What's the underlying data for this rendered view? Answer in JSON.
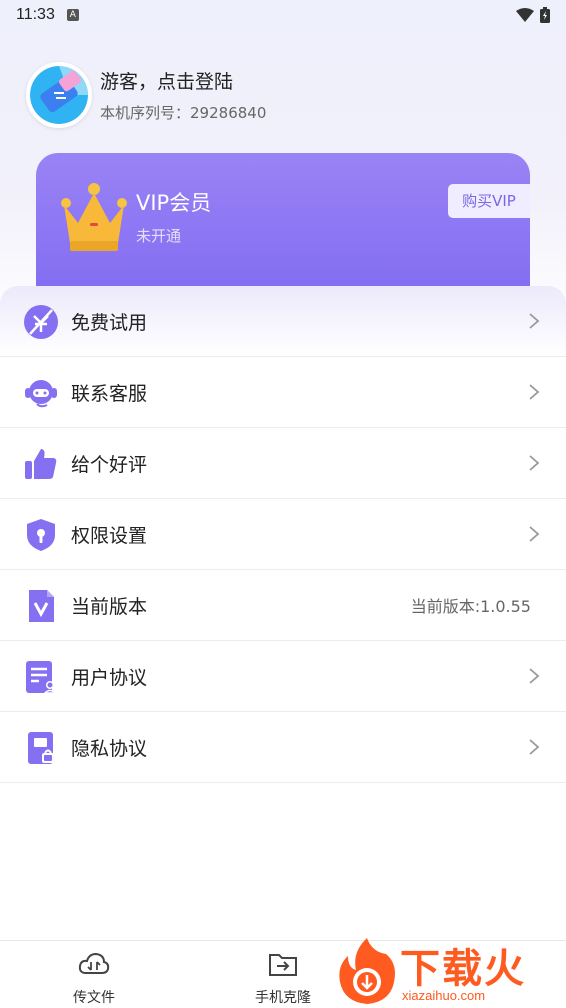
{
  "status_bar": {
    "time": "11:33",
    "notification_glyph": "A"
  },
  "profile": {
    "guest_label": "游客，点击登陆",
    "serial_label": "本机序列号：",
    "serial_number": "29286840"
  },
  "vip": {
    "title": "VIP会员",
    "status": "未开通",
    "buy_label": "购买VIP"
  },
  "menu": {
    "items": [
      {
        "label": "免费试用",
        "icon": "free-trial-icon"
      },
      {
        "label": "联系客服",
        "icon": "customer-service-icon"
      },
      {
        "label": "给个好评",
        "icon": "thumbs-up-icon"
      },
      {
        "label": "权限设置",
        "icon": "shield-icon"
      },
      {
        "label": "当前版本",
        "icon": "version-icon",
        "value": "当前版本:1.0.55"
      },
      {
        "label": "用户协议",
        "icon": "user-agreement-icon"
      },
      {
        "label": "隐私协议",
        "icon": "privacy-agreement-icon"
      }
    ]
  },
  "bottom_nav": {
    "tabs": [
      {
        "label": "传文件",
        "icon": "cloud-transfer-icon"
      },
      {
        "label": "手机克隆",
        "icon": "folder-clone-icon"
      }
    ]
  },
  "watermark": {
    "brand": "下载火",
    "domain": "xiazaihuo.com"
  },
  "colors": {
    "accent": "#8470f0",
    "vip_gradient_top": "#9a83f5",
    "vip_gradient_bottom": "#7f6af1",
    "watermark": "#ff5a1f"
  }
}
